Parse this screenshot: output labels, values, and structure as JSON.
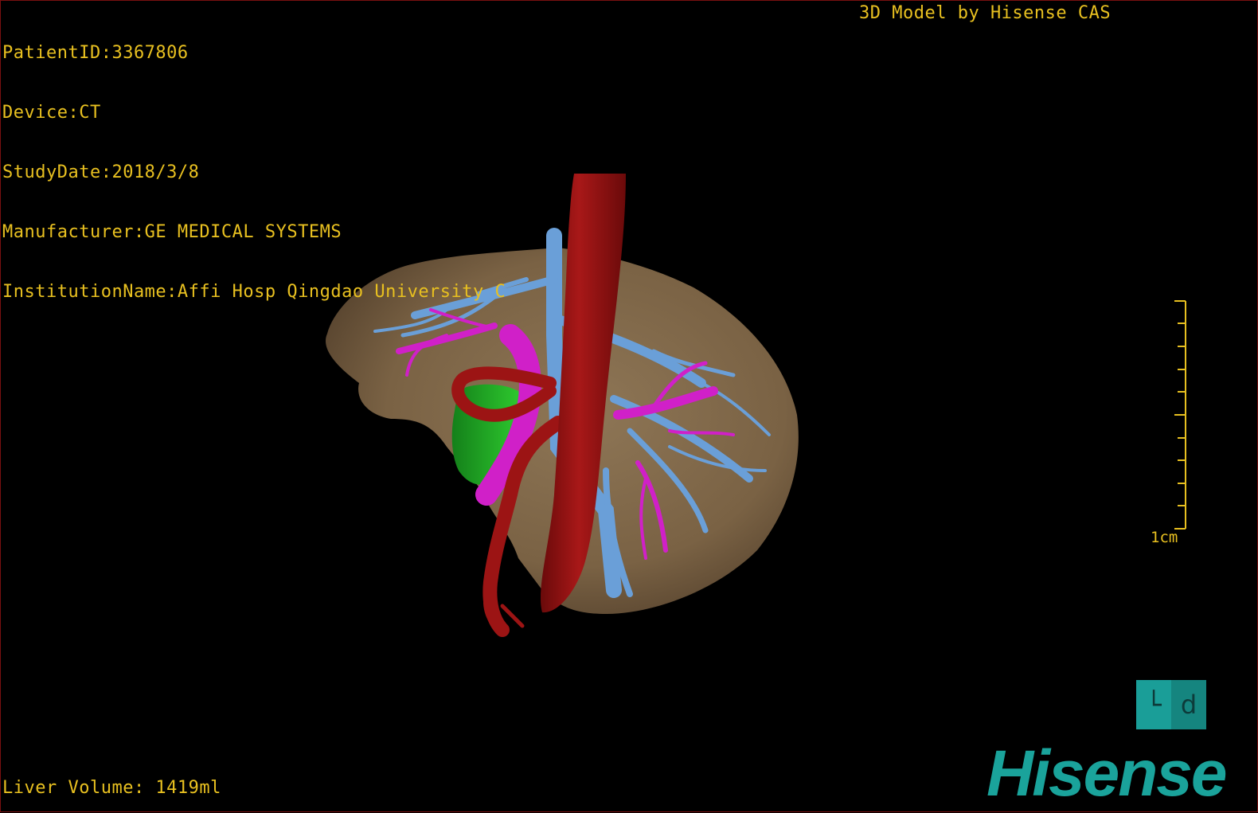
{
  "header": {
    "patient_id": "PatientID:3367806",
    "device": "Device:CT",
    "study_date": "StudyDate:2018/3/8",
    "manufacturer": "Manufacturer:GE MEDICAL SYSTEMS",
    "institution": "InstitutionName:Affi Hosp Qingdao University C"
  },
  "model_label": "3D Model by Hisense CAS",
  "footer": {
    "liver_volume": "Liver Volume: 1419ml"
  },
  "scale": {
    "label": "1cm"
  },
  "orientation": {
    "left_glyph": "└",
    "right_glyph": "d"
  },
  "brand": {
    "name": "Hisense"
  },
  "colors": {
    "text": "#e8c020",
    "liver": "#8b7050",
    "aorta": "#9c1414",
    "hepatic_vein": "#6a9fd8",
    "portal_vein": "#d020c8",
    "gallbladder": "#22b822",
    "brand": "#1aa39b"
  }
}
